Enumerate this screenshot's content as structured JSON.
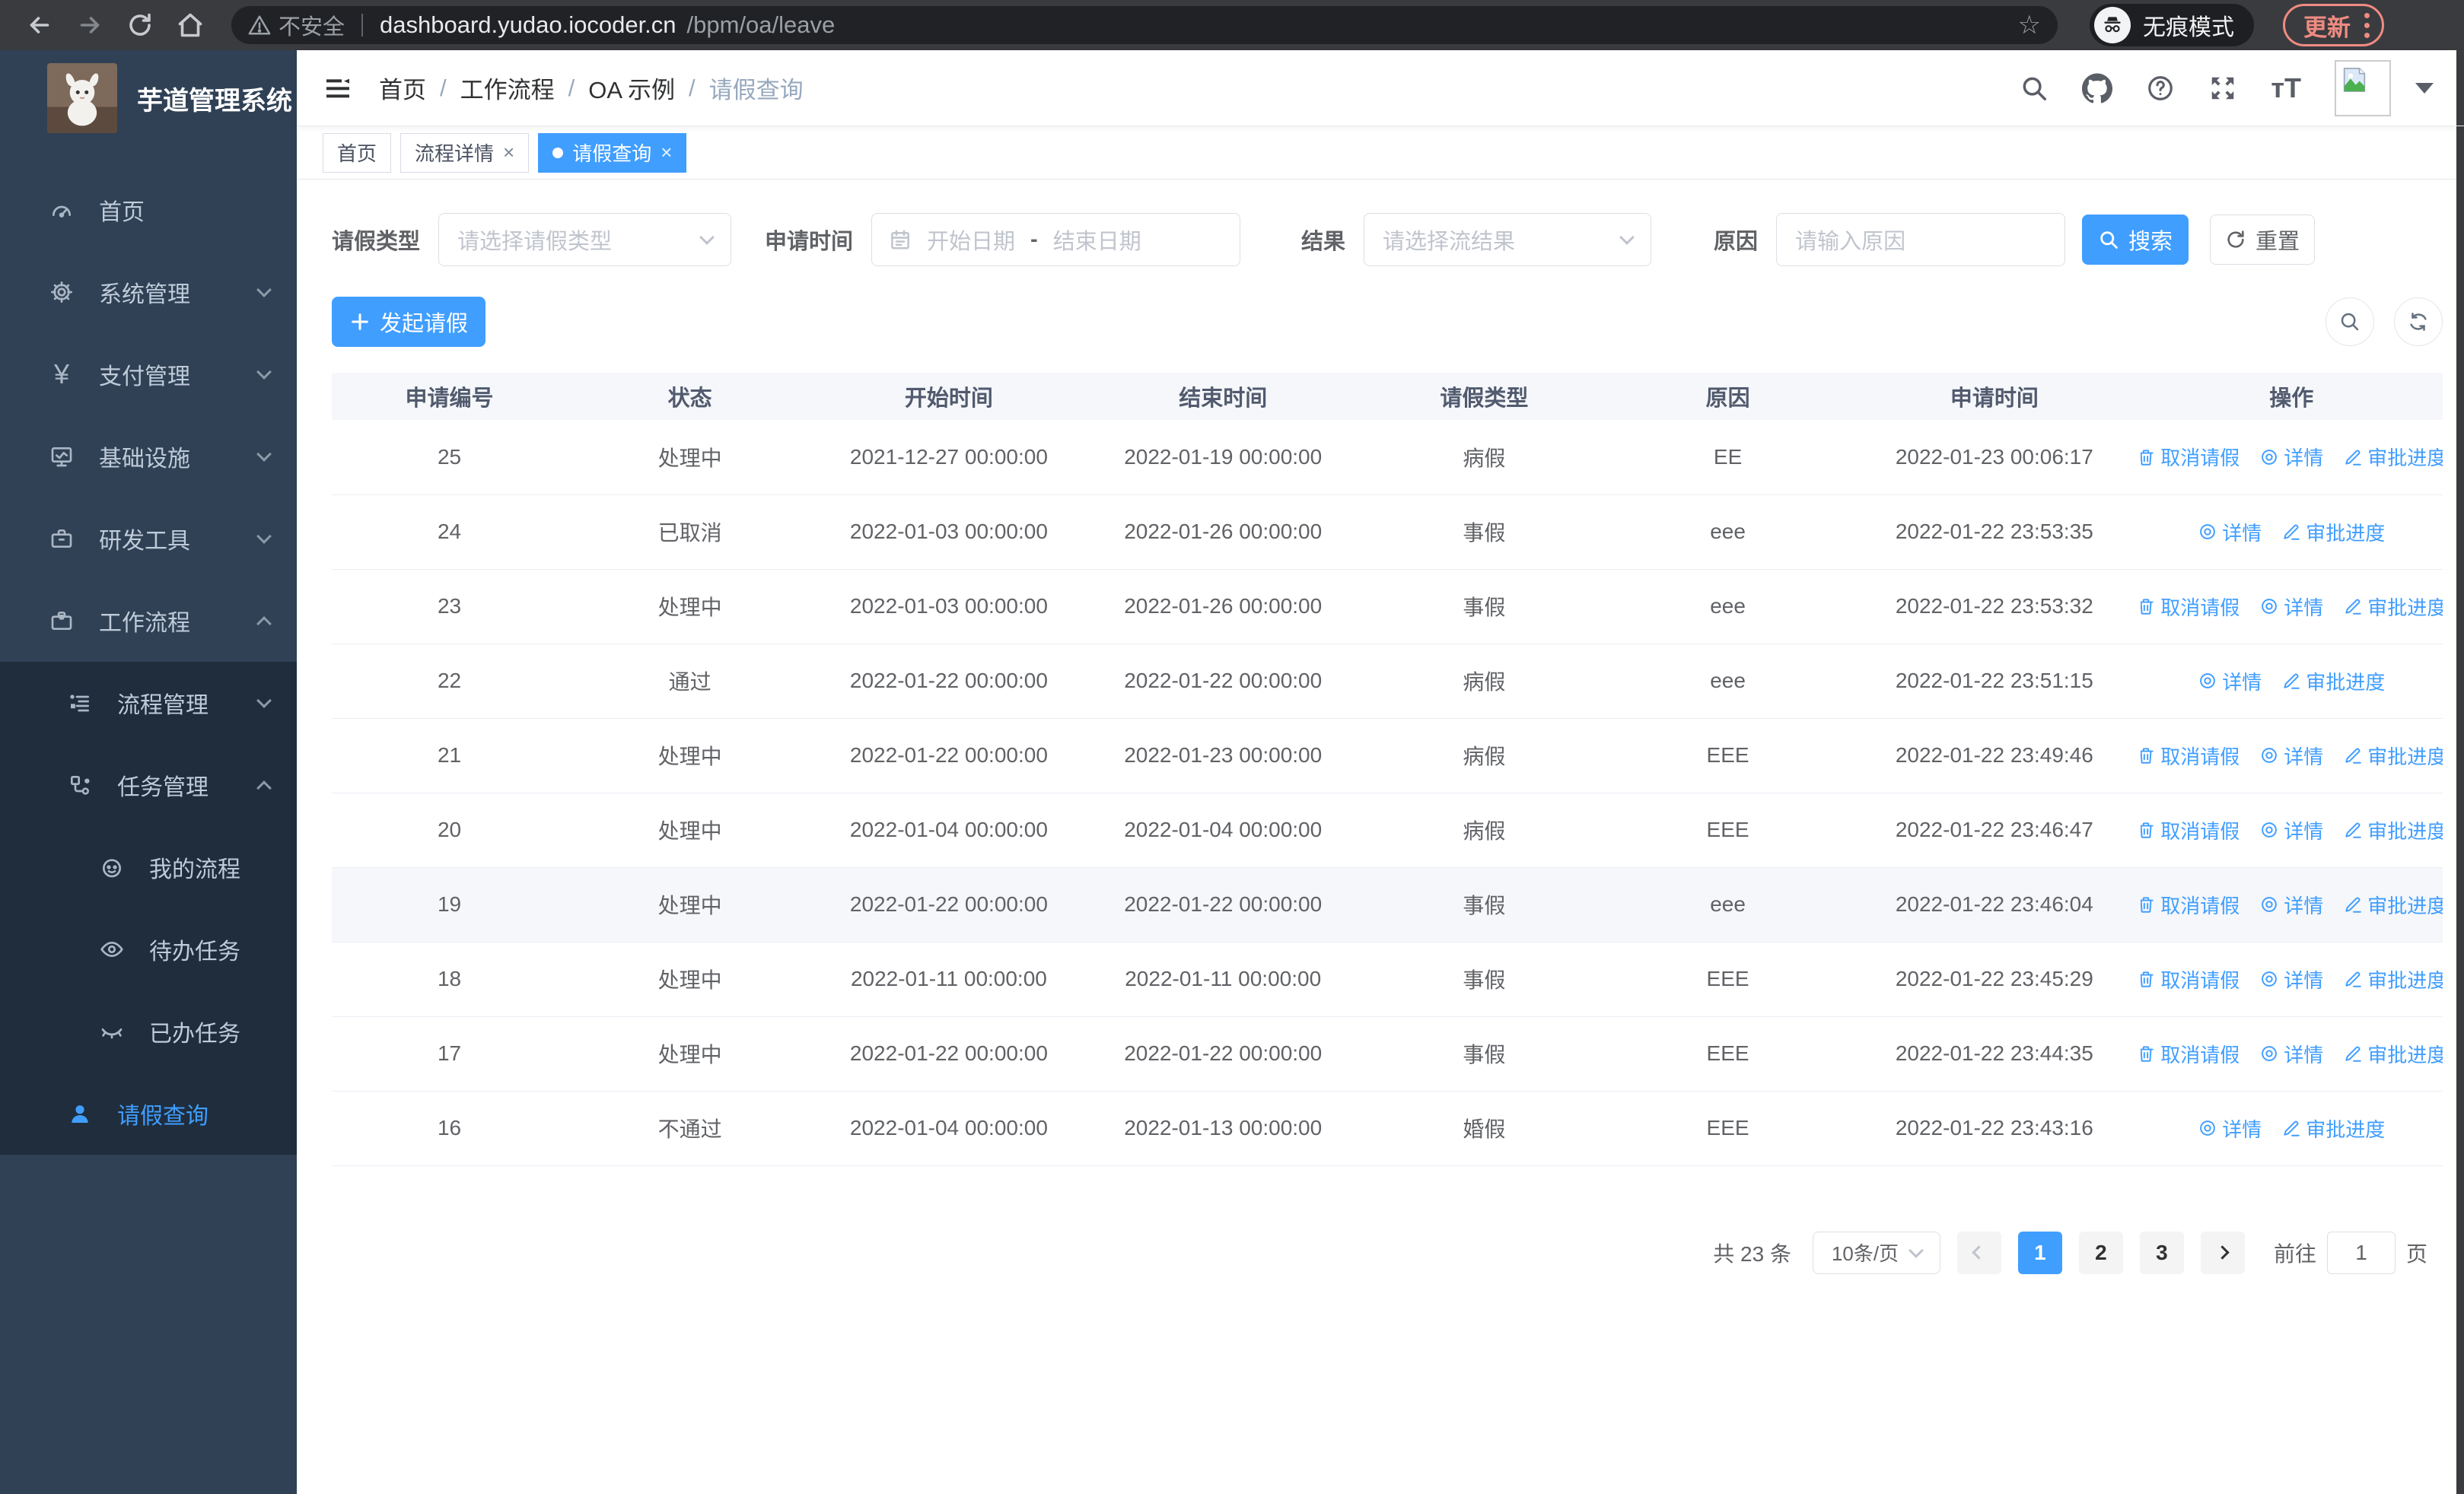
{
  "browser": {
    "security_label": "不安全",
    "url_host": "dashboard.yudao.iocoder.cn",
    "url_path": "/bpm/oa/leave",
    "incognito_label": "无痕模式",
    "update_label": "更新"
  },
  "sidebar": {
    "app_title": "芋道管理系统",
    "items": {
      "home": "首页",
      "system": "系统管理",
      "payment": "支付管理",
      "infra": "基础设施",
      "devtools": "研发工具",
      "workflow": "工作流程",
      "process_mgmt": "流程管理",
      "task_mgmt": "任务管理",
      "my_process": "我的流程",
      "todo_tasks": "待办任务",
      "done_tasks": "已办任务",
      "leave_query": "请假查询"
    }
  },
  "breadcrumb": {
    "items": [
      "首页",
      "工作流程",
      "OA 示例",
      "请假查询"
    ]
  },
  "tabs": [
    {
      "label": "首页"
    },
    {
      "label": "流程详情"
    },
    {
      "label": "请假查询"
    }
  ],
  "filters": {
    "leave_type_label": "请假类型",
    "leave_type_placeholder": "请选择请假类型",
    "apply_time_label": "申请时间",
    "start_date_placeholder": "开始日期",
    "range_separator": "-",
    "end_date_placeholder": "结束日期",
    "result_label": "结果",
    "result_placeholder": "请选择流结果",
    "reason_label": "原因",
    "reason_placeholder": "请输入原因",
    "search_label": "搜索",
    "reset_label": "重置"
  },
  "toolbar": {
    "create_label": "发起请假"
  },
  "actions": {
    "cancel": "取消请假",
    "detail": "详情",
    "progress": "审批进度"
  },
  "table": {
    "headers": [
      "申请编号",
      "状态",
      "开始时间",
      "结束时间",
      "请假类型",
      "原因",
      "申请时间",
      "操作"
    ],
    "rows": [
      {
        "id": "25",
        "status": "处理中",
        "start": "2021-12-27 00:00:00",
        "end": "2022-01-19 00:00:00",
        "type": "病假",
        "reason": "EE",
        "apply_time": "2022-01-23 00:06:17",
        "actions": [
          "cancel",
          "detail",
          "progress"
        ],
        "highlight": false
      },
      {
        "id": "24",
        "status": "已取消",
        "start": "2022-01-03 00:00:00",
        "end": "2022-01-26 00:00:00",
        "type": "事假",
        "reason": "eee",
        "apply_time": "2022-01-22 23:53:35",
        "actions": [
          "detail",
          "progress"
        ],
        "highlight": false
      },
      {
        "id": "23",
        "status": "处理中",
        "start": "2022-01-03 00:00:00",
        "end": "2022-01-26 00:00:00",
        "type": "事假",
        "reason": "eee",
        "apply_time": "2022-01-22 23:53:32",
        "actions": [
          "cancel",
          "detail",
          "progress"
        ],
        "highlight": false
      },
      {
        "id": "22",
        "status": "通过",
        "start": "2022-01-22 00:00:00",
        "end": "2022-01-22 00:00:00",
        "type": "病假",
        "reason": "eee",
        "apply_time": "2022-01-22 23:51:15",
        "actions": [
          "detail",
          "progress"
        ],
        "highlight": false
      },
      {
        "id": "21",
        "status": "处理中",
        "start": "2022-01-22 00:00:00",
        "end": "2022-01-23 00:00:00",
        "type": "病假",
        "reason": "EEE",
        "apply_time": "2022-01-22 23:49:46",
        "actions": [
          "cancel",
          "detail",
          "progress"
        ],
        "highlight": false
      },
      {
        "id": "20",
        "status": "处理中",
        "start": "2022-01-04 00:00:00",
        "end": "2022-01-04 00:00:00",
        "type": "病假",
        "reason": "EEE",
        "apply_time": "2022-01-22 23:46:47",
        "actions": [
          "cancel",
          "detail",
          "progress"
        ],
        "highlight": false
      },
      {
        "id": "19",
        "status": "处理中",
        "start": "2022-01-22 00:00:00",
        "end": "2022-01-22 00:00:00",
        "type": "事假",
        "reason": "eee",
        "apply_time": "2022-01-22 23:46:04",
        "actions": [
          "cancel",
          "detail",
          "progress"
        ],
        "highlight": true
      },
      {
        "id": "18",
        "status": "处理中",
        "start": "2022-01-11 00:00:00",
        "end": "2022-01-11 00:00:00",
        "type": "事假",
        "reason": "EEE",
        "apply_time": "2022-01-22 23:45:29",
        "actions": [
          "cancel",
          "detail",
          "progress"
        ],
        "highlight": false
      },
      {
        "id": "17",
        "status": "处理中",
        "start": "2022-01-22 00:00:00",
        "end": "2022-01-22 00:00:00",
        "type": "事假",
        "reason": "EEE",
        "apply_time": "2022-01-22 23:44:35",
        "actions": [
          "cancel",
          "detail",
          "progress"
        ],
        "highlight": false
      },
      {
        "id": "16",
        "status": "不通过",
        "start": "2022-01-04 00:00:00",
        "end": "2022-01-13 00:00:00",
        "type": "婚假",
        "reason": "EEE",
        "apply_time": "2022-01-22 23:43:16",
        "actions": [
          "detail",
          "progress"
        ],
        "highlight": false
      }
    ]
  },
  "pagination": {
    "total_label": "共 23 条",
    "page_size": "10条/页",
    "pages": [
      "1",
      "2",
      "3"
    ],
    "current": "1",
    "goto_label": "前往",
    "goto_value": "1",
    "page_label": "页"
  },
  "colors": {
    "accent_blue": "#409eff",
    "sidebar_bg": "#304156",
    "submenu_bg": "#1f2d3d",
    "chrome_bg": "#3a3b3f",
    "update_salmon": "#ef8b82",
    "table_border": "#ebeef5"
  }
}
